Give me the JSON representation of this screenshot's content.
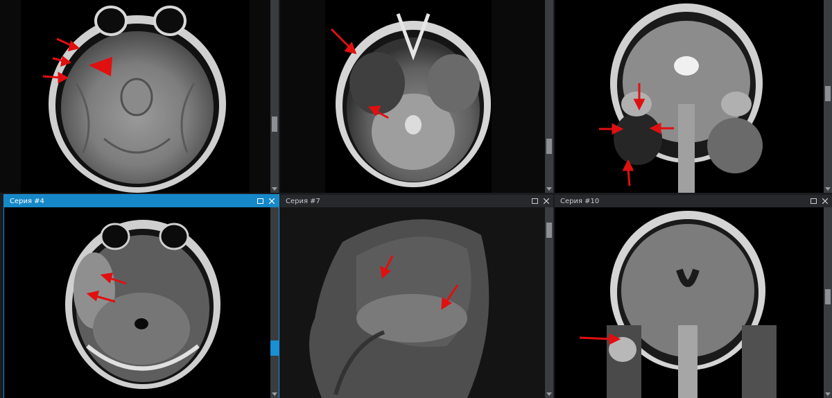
{
  "colors": {
    "active_titlebar": "#1688c8",
    "inactive_titlebar": "#26282b",
    "arrow": "#e01010",
    "scrollbar_thumb_active": "#1a8fd4"
  },
  "viewers": [
    {
      "title": null,
      "slice_position": 0.62
    },
    {
      "title": null,
      "slice_position": 0.74
    },
    {
      "title": null,
      "slice_position": 0.45
    },
    {
      "title": "Серия #4",
      "slice_position": 0.72,
      "active": true
    },
    {
      "title": "Серия #7",
      "slice_position": 0.1
    },
    {
      "title": "Серия #10",
      "slice_position": 0.55
    }
  ],
  "icons": {
    "maximize": "maximize-icon",
    "close": "close-icon",
    "scroll_up": "chevron-up-icon",
    "scroll_down": "chevron-down-icon"
  }
}
